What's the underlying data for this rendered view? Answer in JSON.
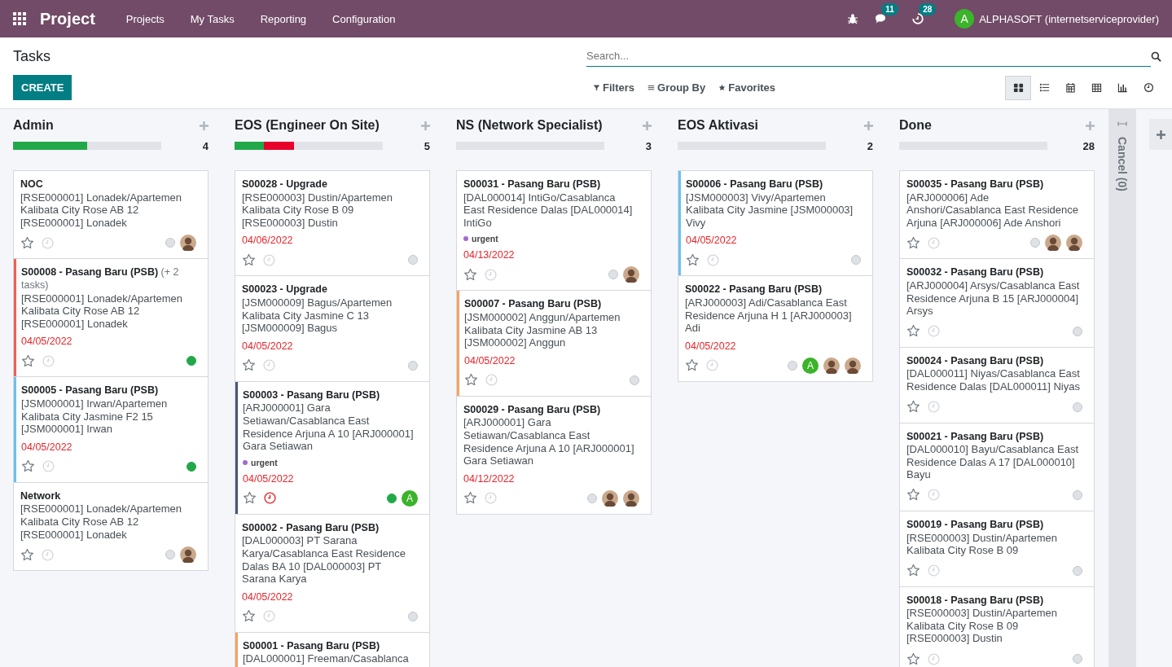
{
  "navbar": {
    "app_name": "Project",
    "menu": [
      "Projects",
      "My Tasks",
      "Reporting",
      "Configuration"
    ],
    "messages_badge": "11",
    "activities_badge": "28",
    "user": {
      "avatar_letter": "A",
      "name": "ALPHASOFT (internetserviceprovider)"
    }
  },
  "control_panel": {
    "breadcrumb": "Tasks",
    "create_label": "CREATE",
    "search": {
      "placeholder": "Search..."
    },
    "filters": [
      {
        "kind": "filter",
        "label": "Filters"
      },
      {
        "kind": "group",
        "label": "Group By"
      },
      {
        "kind": "favorite",
        "label": "Favorites"
      }
    ],
    "views": [
      {
        "kind": "kanban",
        "selected": true
      },
      {
        "kind": "list",
        "selected": false
      },
      {
        "kind": "calendar",
        "selected": false
      },
      {
        "kind": "pivot",
        "selected": false
      },
      {
        "kind": "graph",
        "selected": false
      },
      {
        "kind": "activity",
        "selected": false
      }
    ]
  },
  "columns": [
    {
      "name": "Admin",
      "count": "4",
      "progress": [
        {
          "kind": "done",
          "level": 0.5
        }
      ],
      "cards": [
        {
          "title": "NOC",
          "description": "[RSE000001] Lonadek/Apartemen Kalibata City Rose AB 12 [RSE000001] Lonadek",
          "starred": false,
          "overdue": false,
          "done": false,
          "avatars": [
            {
              "kind": "person"
            }
          ]
        },
        {
          "title": "S00008 - Pasang Baru (PSB)",
          "extra": "(+ 2 tasks)",
          "description": "[RSE000001] Lonadek/Apartemen Kalibata City Rose AB 12 [RSE000001] Lonadek",
          "color": "#f06050",
          "deadline": "04/05/2022",
          "starred": false,
          "overdue": false,
          "done": true
        },
        {
          "title": "S00005 - Pasang Baru (PSB)",
          "description": "[JSM000001] Irwan/Apartemen Kalibata City Jasmine F2 15 [JSM000001] Irwan",
          "color": "#6cc1ed",
          "deadline": "04/05/2022",
          "starred": false,
          "overdue": false,
          "done": true
        },
        {
          "title": "Network",
          "description": "[RSE000001] Lonadek/Apartemen Kalibata City Rose AB 12 [RSE000001] Lonadek",
          "starred": false,
          "overdue": false,
          "done": false,
          "avatars": [
            {
              "kind": "person"
            }
          ]
        }
      ]
    },
    {
      "name": "EOS (Engineer On Site)",
      "count": "5",
      "progress": [
        {
          "kind": "done",
          "level": 0.2
        },
        {
          "kind": "blocked",
          "level": 0.2
        }
      ],
      "cards": [
        {
          "title": "S00028 - Upgrade",
          "description": "[RSE000003] Dustin/Apartemen Kalibata City Rose B 09 [RSE000003] Dustin",
          "deadline": "04/06/2022",
          "starred": false,
          "overdue": false,
          "done": false
        },
        {
          "title": "S00023 - Upgrade",
          "description": "[JSM000009] Bagus/Apartemen Kalibata City Jasmine C 13 [JSM000009] Bagus",
          "deadline": "04/05/2022",
          "starred": false,
          "overdue": false,
          "done": false
        },
        {
          "title": "S00003 - Pasang Baru (PSB)",
          "description": "[ARJ000001] Gara Setiawan/Casablanca East Residence Arjuna A 10 [ARJ000001] Gara Setiawan",
          "color": "#475577",
          "tags": [
            {
              "label": "urgent",
              "color": "#a36ad0"
            }
          ],
          "deadline": "04/05/2022",
          "starred": false,
          "overdue": true,
          "done": true,
          "avatars": [
            {
              "kind": "letter",
              "letter": "A"
            }
          ]
        },
        {
          "title": "S00002 - Pasang Baru (PSB)",
          "description": "[DAL000003] PT Sarana Karya/Casablanca East Residence Dalas BA 10 [DAL000003] PT Sarana Karya",
          "deadline": "04/05/2022",
          "starred": false,
          "overdue": false,
          "done": false
        },
        {
          "title": "S00001 - Pasang Baru (PSB)",
          "description": "[DAL000001] Freeman/Casablanca",
          "color": "#f4a460"
        }
      ]
    },
    {
      "name": "NS (Network Specialist)",
      "count": "3",
      "progress": [
        {
          "kind": "done",
          "level": 0
        },
        {
          "kind": "blocked",
          "level": 0
        }
      ],
      "cards": [
        {
          "title": "S00031 - Pasang Baru (PSB)",
          "description": "[DAL000014] IntiGo/Casablanca East Residence Dalas [DAL000014] IntiGo",
          "tags": [
            {
              "label": "urgent",
              "color": "#a36ad0"
            }
          ],
          "deadline": "04/13/2022",
          "starred": false,
          "overdue": false,
          "done": false,
          "avatars": [
            {
              "kind": "person"
            }
          ]
        },
        {
          "title": "S00007 - Pasang Baru (PSB)",
          "description": "[JSM000002] Anggun/Apartemen Kalibata City Jasmine AB 13 [JSM000002] Anggun",
          "color": "#f4a460",
          "deadline": "04/05/2022",
          "starred": false,
          "overdue": false,
          "done": false
        },
        {
          "title": "S00029 - Pasang Baru (PSB)",
          "description": "[ARJ000001] Gara Setiawan/Casablanca East Residence Arjuna A 10 [ARJ000001] Gara Setiawan",
          "deadline": "04/12/2022",
          "starred": false,
          "overdue": false,
          "done": false,
          "avatars": [
            {
              "kind": "person"
            },
            {
              "kind": "person"
            }
          ]
        }
      ]
    },
    {
      "name": "EOS Aktivasi",
      "count": "2",
      "progress": [
        {
          "kind": "done",
          "level": 0
        },
        {
          "kind": "blocked",
          "level": 0
        }
      ],
      "cards": [
        {
          "title": "S00006 - Pasang Baru (PSB)",
          "description": "[JSM000003] Vivy/Apartemen Kalibata City Jasmine [JSM000003] Vivy",
          "color": "#6cc1ed",
          "deadline": "04/05/2022",
          "starred": false,
          "overdue": false,
          "done": false
        },
        {
          "title": "S00022 - Pasang Baru (PSB)",
          "description": "[ARJ000003] Adi/Casablanca East Residence Arjuna H 1 [ARJ000003] Adi",
          "deadline": "04/05/2022",
          "starred": false,
          "overdue": false,
          "done": false,
          "avatars": [
            {
              "kind": "letter",
              "letter": "A"
            },
            {
              "kind": "person"
            },
            {
              "kind": "person"
            }
          ]
        }
      ]
    },
    {
      "name": "Done",
      "count": "28",
      "progress": [
        {
          "kind": "done",
          "level": 0
        },
        {
          "kind": "blocked",
          "level": 0
        }
      ],
      "cards": [
        {
          "title": "S00035 - Pasang Baru (PSB)",
          "description": "[ARJ000006] Ade Anshori/Casablanca East Residence Arjuna [ARJ000006] Ade Anshori",
          "starred": false,
          "overdue": false,
          "done": false,
          "avatars": [
            {
              "kind": "person"
            },
            {
              "kind": "person"
            }
          ]
        },
        {
          "title": "S00032 - Pasang Baru (PSB)",
          "description": "[ARJ000004] Arsys/Casablanca East Residence Arjuna B 15 [ARJ000004] Arsys",
          "starred": false,
          "overdue": false,
          "done": false
        },
        {
          "title": "S00024 - Pasang Baru (PSB)",
          "description": "[DAL000011] Niyas/Casablanca East Residence Dalas [DAL000011] Niyas",
          "starred": false,
          "overdue": false,
          "done": false
        },
        {
          "title": "S00021 - Pasang Baru (PSB)",
          "description": "[DAL000010] Bayu/Casablanca East Residence Dalas A 17 [DAL000010] Bayu",
          "starred": false,
          "overdue": false,
          "done": false
        },
        {
          "title": "S00019 - Pasang Baru (PSB)",
          "description": "[RSE000003] Dustin/Apartemen Kalibata City Rose B 09",
          "starred": false,
          "overdue": false,
          "done": false
        },
        {
          "title": "S00018 - Pasang Baru (PSB)",
          "description": "[RSE000003] Dustin/Apartemen Kalibata City Rose B 09 [RSE000003] Dustin",
          "starred": false,
          "overdue": false,
          "done": false
        }
      ]
    }
  ],
  "folded_columns": [
    {
      "label": "Cancel (0)"
    }
  ]
}
